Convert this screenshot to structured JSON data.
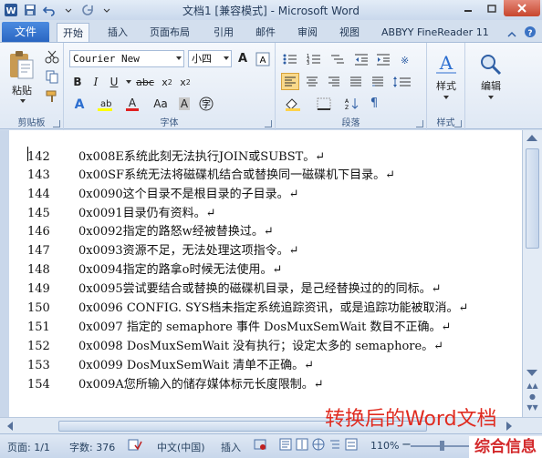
{
  "window": {
    "title": "文档1 [兼容模式] - Microsoft Word"
  },
  "tabs": {
    "file": "文件",
    "items": [
      "开始",
      "插入",
      "页面布局",
      "引用",
      "邮件",
      "审阅",
      "视图",
      "ABBYY FineReader 11"
    ]
  },
  "ribbon": {
    "clipboard": {
      "paste": "粘贴",
      "label": "剪贴板"
    },
    "font": {
      "font_name": "Courier New",
      "font_size": "小四",
      "label": "字体"
    },
    "paragraph": {
      "label": "段落"
    },
    "styles": {
      "label": "样式"
    },
    "editing": {
      "label": "编辑"
    }
  },
  "document": {
    "lines": [
      {
        "num": "142",
        "text": "0x008E系统此刻无法执行JOIN或SUBST。↵"
      },
      {
        "num": "143",
        "text": "0x00SF系统无法将磁碟机结合或替换同一磁碟机下目录。↵"
      },
      {
        "num": "144",
        "text": "0x0090这个目录不是根目录的子目录。↵"
      },
      {
        "num": "145",
        "text": "0x0091目录仍有资料。↵"
      },
      {
        "num": "146",
        "text": "0x0092指定的路怒w经被替换过。↵"
      },
      {
        "num": "147",
        "text": "0x0093资源不足，无法处理这项指令。↵"
      },
      {
        "num": "148",
        "text": "0x0094指定的路拿o时候无法使用。↵"
      },
      {
        "num": "149",
        "text": "0x0095尝试要结合或替换的磁碟机目录，是己经替换过的的同标。↵"
      },
      {
        "num": "150",
        "text": "0x0096 CONFIG. SYS档未指定系统追踪资讯，或是追踪功能被取消。↵"
      },
      {
        "num": "151",
        "text": " 0x0097 指定的 semaphore 事件 DosMuxSemWait 数目不正确。↵"
      },
      {
        "num": "152",
        "text": " 0x0098 DosMuxSemWait 没有执行；设定太多的 semaphore。↵"
      },
      {
        "num": "153",
        "text": " 0x0099 DosMuxSemWait 清单不正确。↵"
      },
      {
        "num": "154",
        "text": " 0x009A您所输入的储存媒体标元长度限制。↵"
      }
    ]
  },
  "caption": "转换后的Word文档",
  "status": {
    "page": "页面: 1/1",
    "words": "字数: 376",
    "language": "中文(中国)",
    "insert": "插入",
    "zoom": "110%"
  },
  "brand": "综合信息"
}
